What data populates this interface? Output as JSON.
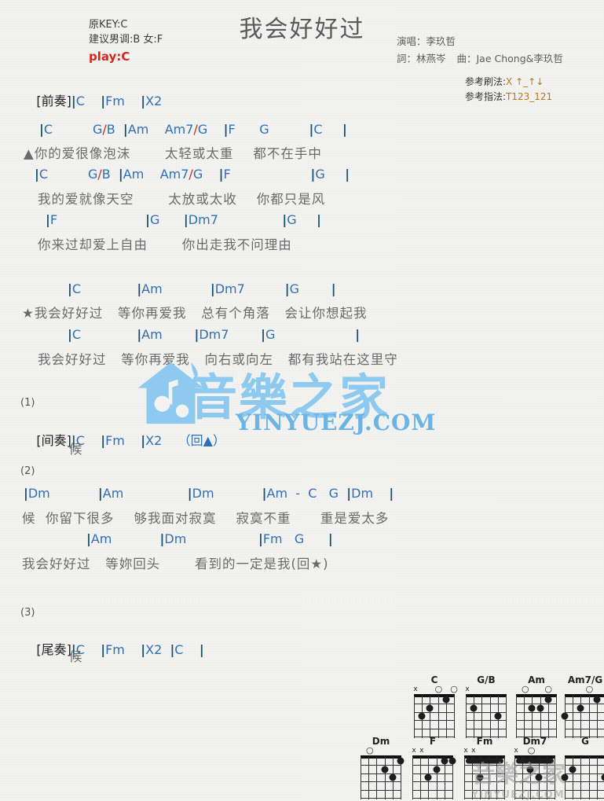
{
  "header": {
    "title": "我会好好过",
    "original_key": "原KEY:C",
    "suggested_key": "建议男调:B 女:F",
    "play_key": "play:C",
    "singer": "演唱：李玖哲",
    "lyricist": "詞：林燕岑",
    "composer": "曲：Jae Chong&李玖哲",
    "strum_label": "参考刷法:",
    "strum_value": "X ↑_↑↓",
    "fingering_label": "参考指法:",
    "fingering_value": "T123_121"
  },
  "sections": {
    "intro": {
      "label": "[前奏]",
      "chords": "|C    |Fm    |X2"
    },
    "interlude": {
      "number": "(1)",
      "label": "[间奏]",
      "chords": "|C    |Fm    |X2    （回▲）",
      "lyric": "候"
    },
    "bridge_number": "(2)",
    "outro": {
      "number": "(3)",
      "label": "[尾奏]",
      "chords": "|C    |Fm    |X2  |C    |",
      "lyric": "候"
    }
  },
  "verse1": [
    {
      "chords": "|C          G/B  |Am    Am7/G    |F      G          |C     |",
      "lyric": "▲你的爱很像泡沫       太轻或太重    都不在手中"
    },
    {
      "chords": "|C          G/B  |Am    Am7/G    |F                    |G     |",
      "lyric": "我的爱就像天空       太放或太收    你都只是风"
    },
    {
      "chords": "|F                      |G      |Dm7                |G     |",
      "lyric": "你来过却爱上自由       你出走我不问理由"
    }
  ],
  "chorus": [
    {
      "chords": "|C              |Am            |Dm7          |G        |",
      "lyric": "★我会好好过   等你再爱我   总有个角落   会让你想起我"
    },
    {
      "chords": "|C              |Am        |Dm7        |G                    |",
      "lyric": "我会好好过   等你再爱我   向右或向左   都有我站在这里守"
    }
  ],
  "bridge": [
    {
      "chords": "|Dm            |Am                |Dm            |Am  -  C   G  |Dm    |",
      "lyric": "候  你留下很多    够我面对寂寞    寂寞不重      重是爱太多"
    },
    {
      "chords": "|Am            |Dm                  |Fm   G      |",
      "lyric": "我会好好过   等妳回头       看到的一定是我(回★)"
    }
  ],
  "watermark": {
    "text_cn": "音樂之家",
    "domain": "YINYUEZJ.COM"
  },
  "chord_diagrams": [
    {
      "name": "C",
      "markers": [
        "x",
        "",
        "",
        "o",
        "",
        "o"
      ],
      "dots": [
        [
          2,
          1
        ],
        [
          4,
          2
        ],
        [
          5,
          3
        ]
      ],
      "barre": null
    },
    {
      "name": "G/B",
      "markers": [
        "x",
        "",
        "",
        "",
        "",
        ""
      ],
      "dots": [
        [
          5,
          2
        ],
        [
          2,
          3
        ]
      ],
      "barre": null
    },
    {
      "name": "Am",
      "markers": [
        "",
        "o",
        "",
        "",
        "o",
        ""
      ],
      "dots": [
        [
          4,
          2
        ],
        [
          3,
          2
        ],
        [
          2,
          1
        ]
      ],
      "barre": null
    },
    {
      "name": "Am7/G",
      "markers": [
        "",
        "",
        "",
        "o",
        "",
        ""
      ],
      "dots": [
        [
          6,
          3
        ],
        [
          4,
          2
        ],
        [
          2,
          1
        ]
      ],
      "barre": null
    },
    {
      "name": "Dm",
      "markers": [
        "",
        "o",
        "",
        "",
        "",
        ""
      ],
      "dots": [
        [
          1,
          1
        ],
        [
          3,
          2
        ],
        [
          2,
          3
        ]
      ],
      "barre": null
    },
    {
      "name": "F",
      "markers": [
        "x",
        "x",
        "",
        "",
        "",
        ""
      ],
      "dots": [
        [
          4,
          3
        ],
        [
          3,
          2
        ],
        [
          2,
          1
        ],
        [
          1,
          1
        ]
      ],
      "barre": null
    },
    {
      "name": "Fm",
      "markers": [
        "x",
        "x",
        "",
        "",
        "",
        ""
      ],
      "dots": [
        [
          4,
          3
        ]
      ],
      "barre": 1
    },
    {
      "name": "Dm7",
      "markers": [
        "x",
        "",
        "o",
        "",
        "",
        ""
      ],
      "dots": [
        [
          4,
          2
        ],
        [
          3,
          3
        ]
      ],
      "barre": 1
    },
    {
      "name": "G",
      "markers": [
        "",
        "",
        "",
        "",
        "",
        ""
      ],
      "dots": [
        [
          5,
          2
        ],
        [
          6,
          3
        ],
        [
          1,
          3
        ]
      ],
      "barre": null
    }
  ]
}
